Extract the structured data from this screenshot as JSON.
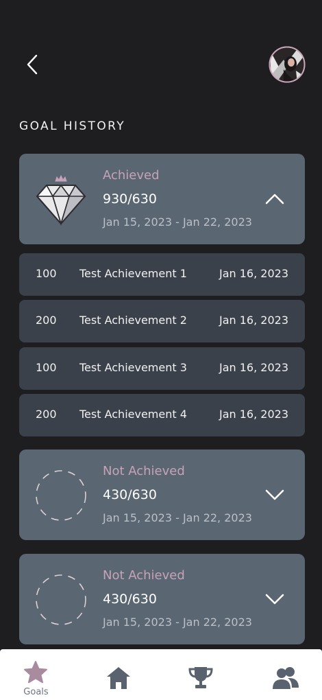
{
  "header": {
    "back_icon": "chevron-left-icon",
    "avatar_icon": "user-avatar"
  },
  "section_title": "GOAL HISTORY",
  "goals": [
    {
      "status": "Achieved",
      "score": "930/630",
      "dates": "Jan 15, 2023 - Jan 22, 2023",
      "emblem": "diamond-crown-icon",
      "expanded": true,
      "achievements": [
        {
          "points": "100",
          "name": "Test Achievement 1",
          "date": "Jan 16, 2023"
        },
        {
          "points": "200",
          "name": "Test Achievement 2",
          "date": "Jan 16, 2023"
        },
        {
          "points": "100",
          "name": "Test Achievement 3",
          "date": "Jan 16, 2023"
        },
        {
          "points": "200",
          "name": "Test Achievement 4",
          "date": "Jan 16, 2023"
        }
      ]
    },
    {
      "status": "Not Achieved",
      "score": "430/630",
      "dates": "Jan 15, 2023 - Jan 22, 2023",
      "emblem": "dashed-circle-icon",
      "expanded": false
    },
    {
      "status": "Not Achieved",
      "score": "430/630",
      "dates": "Jan 15, 2023 - Jan 22, 2023",
      "emblem": "dashed-circle-icon",
      "expanded": false
    }
  ],
  "nav": {
    "items": [
      {
        "label": "Goals",
        "icon": "star-icon",
        "active": true
      },
      {
        "label": "",
        "icon": "home-icon",
        "active": false
      },
      {
        "label": "",
        "icon": "trophy-icon",
        "active": false
      },
      {
        "label": "",
        "icon": "people-icon",
        "active": false
      }
    ]
  },
  "colors": {
    "background": "#1e1e20",
    "card": "#5b6673",
    "row": "#3a414b",
    "status_accent": "#c6a3b8",
    "nav_active": "#a98ba0",
    "nav_inactive": "#59626e"
  }
}
